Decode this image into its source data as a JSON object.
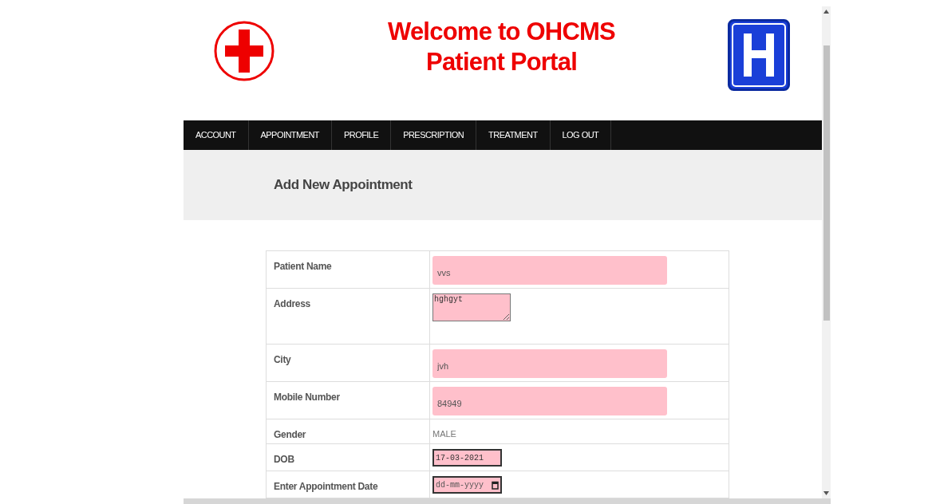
{
  "header": {
    "title_line_1": "Welcome to OHCMS",
    "title_line_2": "Patient Portal"
  },
  "nav": {
    "items": [
      {
        "label": "ACCOUNT"
      },
      {
        "label": "APPOINTMENT"
      },
      {
        "label": "PROFILE"
      },
      {
        "label": "PRESCRIPTION"
      },
      {
        "label": "TREATMENT"
      },
      {
        "label": "LOG OUT"
      }
    ]
  },
  "page_title": "Add New Appointment",
  "form": {
    "rows": [
      {
        "label": "Patient Name",
        "kind": "text",
        "value": "vvs"
      },
      {
        "label": "Address",
        "kind": "textarea",
        "value": "hghgyt"
      },
      {
        "label": "City",
        "kind": "text",
        "value": "jvh"
      },
      {
        "label": "Mobile Number",
        "kind": "text",
        "value": "84949"
      },
      {
        "label": "Gender",
        "kind": "static",
        "value": "MALE"
      },
      {
        "label": "DOB",
        "kind": "date",
        "value": "17-03-2021"
      },
      {
        "label": "Enter Appointment Date",
        "kind": "date",
        "placeholder": "dd-mm-yyyy"
      }
    ]
  }
}
